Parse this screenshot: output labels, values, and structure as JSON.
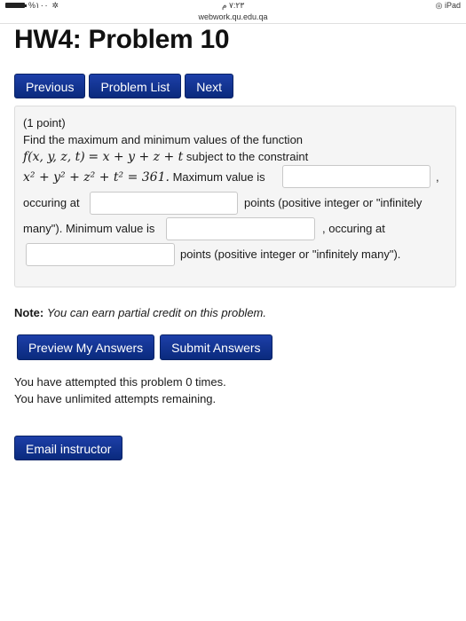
{
  "status_bar": {
    "battery": "%١٠٠",
    "time": "٧:٢٣ م",
    "device": "iPad"
  },
  "browser": {
    "url": "webwork.qu.edu.qa"
  },
  "page": {
    "title": "HW4: Problem 10"
  },
  "nav": {
    "previous": "Previous",
    "problem_list": "Problem List",
    "next": "Next"
  },
  "problem": {
    "points": "(1 point)",
    "intro": "Find the maximum and minimum values of the function",
    "function_lhs": "f(x, y, z, t)",
    "function_rhs": "x + y + z + t",
    "subject_to": "subject to the constraint",
    "constraint": "x² + y² + z² + t² = 361.",
    "max_label": "Maximum value is",
    "comma": ",",
    "occurring_at_1": "occuring at",
    "points_hint_1": "points (positive integer or \"infinitely",
    "many_min": "many\"). Minimum value is",
    "occurring_at_2": ", occuring at",
    "points_hint_2": "points (positive integer or \"infinitely many\").",
    "answers": {
      "max_value": "",
      "max_points": "",
      "min_value": "",
      "min_points": ""
    }
  },
  "note": {
    "label": "Note:",
    "text": "You can earn partial credit on this problem."
  },
  "actions": {
    "preview": "Preview My Answers",
    "submit": "Submit Answers"
  },
  "attempts": {
    "line1": "You have attempted this problem 0 times.",
    "line2": "You have unlimited attempts remaining."
  },
  "footer": {
    "email": "Email instructor"
  }
}
